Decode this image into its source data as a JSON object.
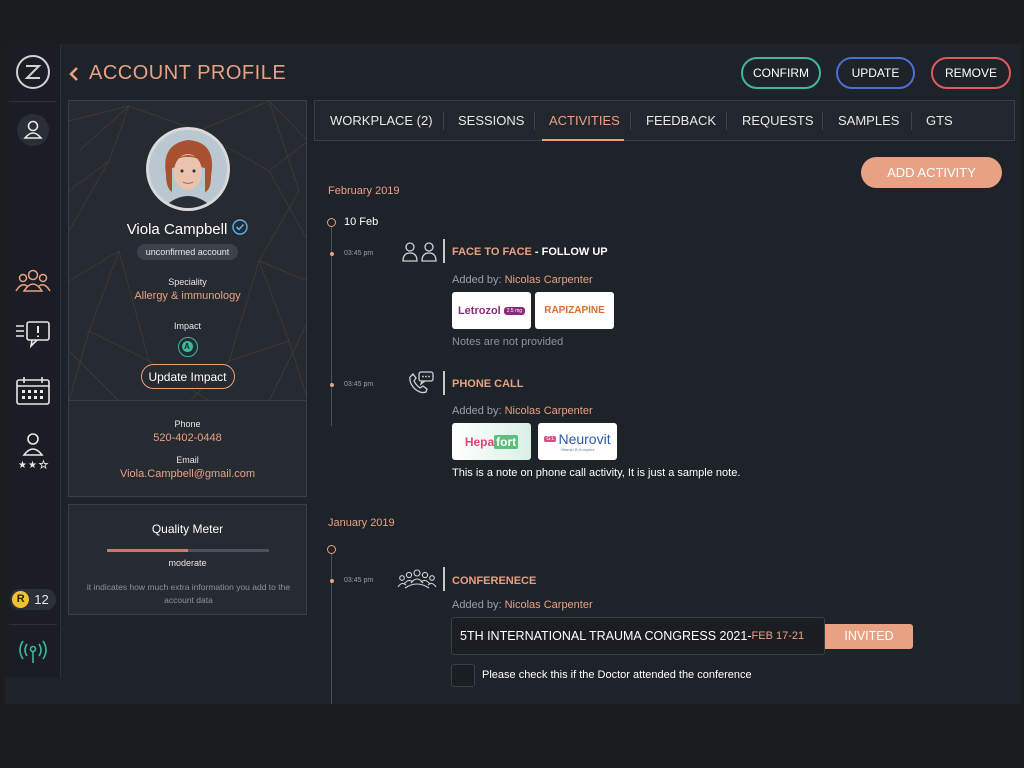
{
  "header": {
    "title": "ACCOUNT PROFILE",
    "confirm_label": "CONFIRM",
    "update_label": "UPDATE",
    "remove_label": "REMOVE",
    "colors": {
      "confirm": "#3fb89a",
      "update": "#4a6fd8",
      "remove": "#e05b5b",
      "accent": "#e9a184"
    }
  },
  "sidebar": {
    "icons": [
      "logo-icon",
      "user-icon",
      "users-group-icon",
      "alert-message-icon",
      "calendar-icon",
      "rated-user-icon",
      "signal-icon"
    ],
    "points_badge": "12"
  },
  "profile": {
    "name": "Viola Campbell",
    "status": "unconfirmed account",
    "speciality_label": "Speciality",
    "speciality": "Allergy & immunology",
    "impact_label": "Impact",
    "impact_value": "A",
    "update_impact_label": "Update Impact",
    "phone_label": "Phone",
    "phone": "520-402-0448",
    "email_label": "Email",
    "email": "Viola.Campbell@gmail.com"
  },
  "quality": {
    "title": "Quality Meter",
    "level_text": "moderate",
    "level_fraction": 0.5,
    "description": "it indicates how much extra information you add to the account data"
  },
  "tabs": [
    "WORKPLACE (2)",
    "SESSIONS",
    "ACTIVITIES",
    "FEEDBACK",
    "REQUESTS",
    "SAMPLES",
    "GTS"
  ],
  "active_tab": "ACTIVITIES",
  "add_activity_label": "ADD ACTIVITY",
  "timeline": {
    "feb": {
      "month": "February 2019",
      "day": "10 Feb",
      "act1": {
        "time": "03:45 pm",
        "title_type": "FACE TO FACE",
        "title_sep": " - ",
        "title_sub": "FOLLOW UP",
        "added_prefix": "Added by: ",
        "added_by": "Nicolas Carpenter",
        "logos": {
          "letrozol": "Letrozol",
          "letrozol_tag": "2.5 mg",
          "rapizapine": "RAPIZAPINE"
        },
        "note": "Notes are not provided"
      },
      "act2": {
        "time": "03:45 pm",
        "title": "PHONE CALL",
        "added_prefix": "Added by: ",
        "added_by": "Nicolas Carpenter",
        "logos": {
          "hepa": "Hepa",
          "fort": "fort",
          "neurovit": "Neurovit",
          "neurovit_sub": "Vitamin B-Komplex",
          "neurovit_tag": "G:L"
        },
        "note": "This is a note on phone call activity, It is just a sample note."
      }
    },
    "jan": {
      "month": "January 2019",
      "act3": {
        "time": "03:45 pm",
        "title": "CONFERENECE",
        "added_prefix": "Added by: ",
        "added_by": "Nicolas Carpenter",
        "conference_name": "5TH INTERNATIONAL TRAUMA CONGRESS 2021",
        "conference_sep": " - ",
        "conference_dates": "FEB 17-21",
        "invite_status": "INVITED",
        "checkbox_label": "Please check this if the Doctor attended the conference"
      }
    }
  }
}
